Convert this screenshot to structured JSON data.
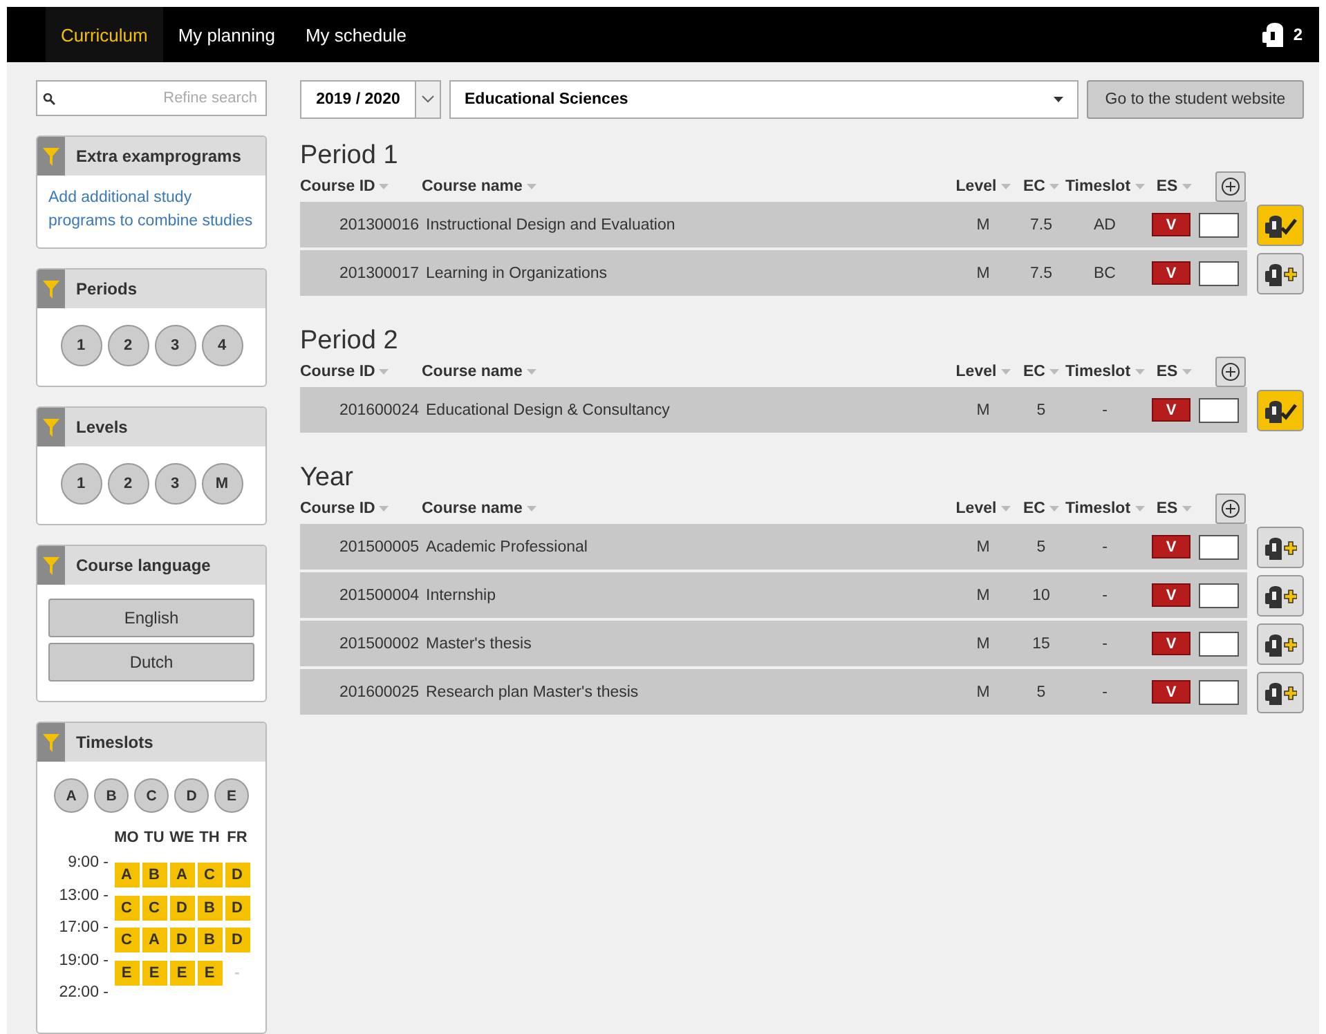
{
  "nav": {
    "tabs": [
      {
        "label": "Curriculum",
        "selected": true
      },
      {
        "label": "My planning",
        "selected": false
      },
      {
        "label": "My schedule",
        "selected": false
      }
    ],
    "basket_count": "2"
  },
  "toolbar": {
    "search": {
      "placeholder": "Refine search"
    },
    "year": "2019 / 2020",
    "program": "Educational Sciences",
    "student_website_button": "Go to the student website"
  },
  "sidebar": {
    "extra": {
      "title": "Extra examprograms",
      "link": "Add additional study programs to combine studies"
    },
    "periods": {
      "title": "Periods",
      "options": [
        {
          "label": "1",
          "selected": false
        },
        {
          "label": "2",
          "selected": false
        },
        {
          "label": "3",
          "selected": false
        },
        {
          "label": "4",
          "selected": false
        }
      ]
    },
    "levels": {
      "title": "Levels",
      "options": [
        {
          "label": "1",
          "selected": false
        },
        {
          "label": "2",
          "selected": false
        },
        {
          "label": "3",
          "selected": false
        },
        {
          "label": "M",
          "selected": false
        }
      ]
    },
    "language": {
      "title": "Course language",
      "options": [
        {
          "label": "English",
          "selected": false
        },
        {
          "label": "Dutch",
          "selected": false
        }
      ]
    },
    "timeslots": {
      "title": "Timeslots",
      "options": [
        {
          "label": "A",
          "selected": false
        },
        {
          "label": "B",
          "selected": false
        },
        {
          "label": "C",
          "selected": false
        },
        {
          "label": "D",
          "selected": false
        },
        {
          "label": "E",
          "selected": false
        }
      ],
      "days": [
        "MO",
        "TU",
        "WE",
        "TH",
        "FR"
      ],
      "times": [
        "9:00 -",
        "13:00 -",
        "17:00 -",
        "19:00 -",
        "22:00 -"
      ],
      "grid": [
        [
          {
            "label": "A",
            "kind": "slot"
          },
          {
            "label": "B",
            "kind": "slot"
          },
          {
            "label": "A",
            "kind": "slot"
          },
          {
            "label": "C",
            "kind": "slot"
          },
          {
            "label": "D",
            "kind": "slot"
          }
        ],
        [
          {
            "label": "C",
            "kind": "slot"
          },
          {
            "label": "C",
            "kind": "slot"
          },
          {
            "label": "D",
            "kind": "slot"
          },
          {
            "label": "B",
            "kind": "slot"
          },
          {
            "label": "D",
            "kind": "slot"
          }
        ],
        [
          {
            "label": "C",
            "kind": "slot"
          },
          {
            "label": "A",
            "kind": "slot"
          },
          {
            "label": "D",
            "kind": "slot"
          },
          {
            "label": "B",
            "kind": "slot"
          },
          {
            "label": "D",
            "kind": "slot"
          }
        ],
        [
          {
            "label": "E",
            "kind": "slot"
          },
          {
            "label": "E",
            "kind": "slot"
          },
          {
            "label": "E",
            "kind": "slot"
          },
          {
            "label": "E",
            "kind": "slot"
          },
          {
            "label": "-",
            "kind": "none"
          }
        ]
      ]
    }
  },
  "sections": [
    {
      "title": "Period 1",
      "columns": [
        "Course ID",
        "Course name",
        "Level",
        "EC",
        "Timeslot",
        "ES"
      ],
      "courses": [
        {
          "id": "201300016",
          "name": "Instructional Design and Evaluation",
          "level": "M",
          "ec": "7.5",
          "timeslot": "AD",
          "es": "V",
          "checked": false,
          "planned": true
        },
        {
          "id": "201300017",
          "name": "Learning in Organizations",
          "level": "M",
          "ec": "7.5",
          "timeslot": "BC",
          "es": "V",
          "checked": false,
          "planned": false
        }
      ]
    },
    {
      "title": "Period 2",
      "columns": [
        "Course ID",
        "Course name",
        "Level",
        "EC",
        "Timeslot",
        "ES"
      ],
      "courses": [
        {
          "id": "201600024",
          "name": "Educational Design & Consultancy",
          "level": "M",
          "ec": "5",
          "timeslot": "-",
          "es": "V",
          "checked": false,
          "planned": true
        }
      ]
    },
    {
      "title": "Year",
      "columns": [
        "Course ID",
        "Course name",
        "Level",
        "EC",
        "Timeslot",
        "ES"
      ],
      "courses": [
        {
          "id": "201500005",
          "name": "Academic Professional",
          "level": "M",
          "ec": "5",
          "timeslot": "-",
          "es": "V",
          "checked": false,
          "planned": false
        },
        {
          "id": "201500004",
          "name": "Internship",
          "level": "M",
          "ec": "10",
          "timeslot": "-",
          "es": "V",
          "checked": false,
          "planned": false
        },
        {
          "id": "201500002",
          "name": "Master's thesis",
          "level": "M",
          "ec": "15",
          "timeslot": "-",
          "es": "V",
          "checked": false,
          "planned": false
        },
        {
          "id": "201600025",
          "name": "Research plan Master's thesis",
          "level": "M",
          "ec": "5",
          "timeslot": "-",
          "es": "V",
          "checked": false,
          "planned": false
        }
      ]
    }
  ]
}
